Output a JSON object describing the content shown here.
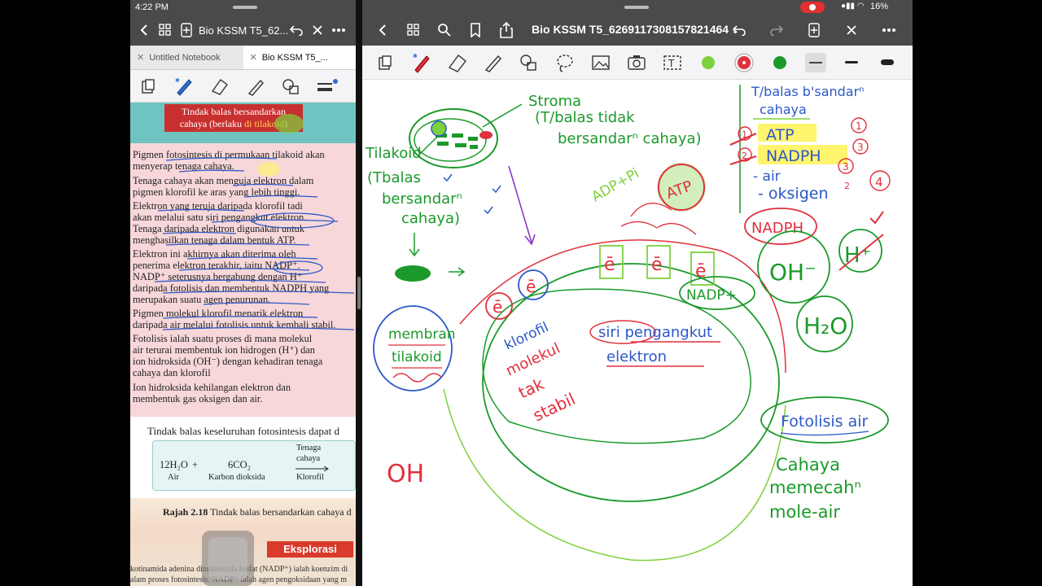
{
  "left_pane": {
    "status": {
      "time": "4:22 PM"
    },
    "nav": {
      "title": "Bio KSSM T5_62..."
    },
    "tabs": [
      {
        "label": "Untitled Notebook",
        "active": false
      },
      {
        "label": "Bio KSSM T5_...",
        "active": true
      }
    ],
    "page": {
      "banner_line1": "Tindak balas bersandarkan",
      "banner_line2_a": "cahaya (berlaku ",
      "banner_line2_b": "di tilakoid",
      "banner_line2_c": ")",
      "lines": [
        "Pigmen fotosintesis di permukaan tilakoid akan",
        "menyerap tenaga cahaya.",
        "Tenaga cahaya akan menguja elektron dalam",
        "pigmen klorofil ke aras yang lebih tinggi.",
        "Elektron yang teruja daripada klorofil tadi",
        "akan melalui satu siri pengangkut elektron.",
        "Tenaga daripada elektron digunakan untuk",
        "menghasilkan tenaga dalam bentuk ATP.",
        "Elektron ini akhirnya akan diterima oleh",
        "penerima elektron terakhir, iaitu NADP⁺.",
        "NADP⁺ seterusnya bergabung dengan H⁺",
        "daripada fotolisis dan membentuk NADPH yang",
        "merupakan suatu agen penurunan.",
        "Pigmen molekul klorofil menarik elektron",
        "daripada air melalui fotolisis untuk kembali stabil.",
        "Fotolisis ialah suatu proses di mana molekul",
        "air terurai membentuk ion hidrogen (H⁺) dan",
        "ion hidroksida (OH⁻) dengan kehadiran tenaga",
        "cahaya dan klorofil",
        "Ion hidroksida kehilangan elektron dan",
        "membentuk gas oksigen dan air."
      ],
      "summary": "Tindak balas keseluruhan fotosintesis dapat d",
      "eq_water": "12H₂O",
      "eq_plus": "+",
      "eq_co2": "6CO₂",
      "eq_water_label": "Air",
      "eq_co2_label": "Karbon dioksida",
      "eq_arrow_top1": "Tenaga",
      "eq_arrow_top2": "cahaya",
      "eq_arrow_bottom": "Klorofil",
      "rajah_num": "Rajah 2.18",
      "rajah_text": " Tindak balas bersandarkan cahaya d",
      "eksplorasi": "Eksplorasi",
      "footer1": "kotinamida adenina dinukleotida fosfat (NADP⁺) ialah koenzim di",
      "footer2": "alam proses fotosintesis. NADP⁺ ialah agen pengoksidaan yang m"
    }
  },
  "right_pane": {
    "status": {
      "battery": "16%"
    },
    "nav": {
      "title": "Bio KSSM T5_6269117308157821464"
    },
    "colors": {
      "green": "#7dd13c",
      "red": "#e0303e",
      "darkgreen": "#1a9a2a"
    },
    "notes": {
      "stroma": "Stroma",
      "stroma_note1": "(T/balas tidak",
      "stroma_note2": "bersandarⁿ cahaya)",
      "tilakoid": "Tilakoid",
      "tilakoid_note1": "(Tbalas",
      "tilakoid_note2": "bersandarⁿ",
      "tilakoid_note3": "cahaya)",
      "adp": "ADP+Pi",
      "atp": "ATP",
      "e1": "ē",
      "e2": "ē",
      "e3": "ē",
      "e4": "ē",
      "e5": "ē",
      "nadp_plus": "NADP+",
      "nadph": "NADPH",
      "oh_minus": "OH⁻",
      "h_plus": "H⁺",
      "h2o": "H₂O",
      "membran": "membran",
      "tilakoid2": "tilakoid",
      "klorofil": "klorofil",
      "molekul": "molekul",
      "tak": "tak",
      "stabil": "stabil",
      "siri": "siri pengangkut",
      "elektron": "elektron",
      "oh_plain": "OH",
      "fotolisis": "Fotolisis air",
      "cahaya_memecah1": "Cahaya",
      "cahaya_memecah2": "memecahⁿ",
      "cahaya_memecah3": "mole-air",
      "list_title1": "T/balas b'sandarⁿ",
      "list_title2": "cahaya",
      "list_atp": "ATP",
      "list_nadph": "NADPH",
      "list_air": "- air",
      "list_oksigen": "- oksigen",
      "num1": "1",
      "num2": "2",
      "num3": "3",
      "num4": "4",
      "num3b": "3",
      "num1b": "1",
      "num2b": "2"
    }
  }
}
